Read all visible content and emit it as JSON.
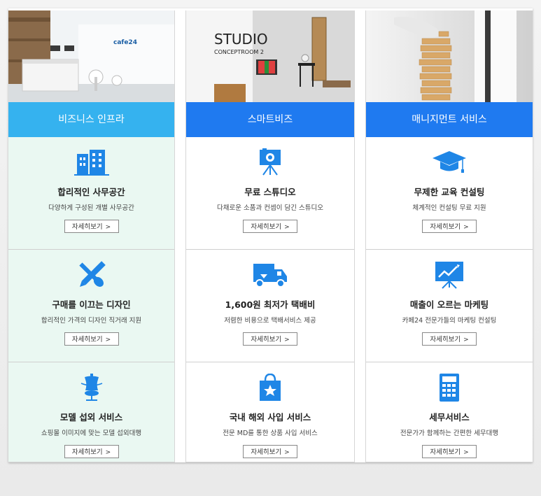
{
  "columns": [
    {
      "header": "비즈니스 인프라",
      "photo_logo": "cafe24",
      "cells": [
        {
          "icon": "building-icon",
          "title": "합리적인 사무공간",
          "desc": "다양하게 구성된 개별 사무공간",
          "button": "자세히보기"
        },
        {
          "icon": "design-tools-icon",
          "title": "구매를 이끄는 디자인",
          "desc": "합리적인 가격의 디자인 직거래 지원",
          "button": "자세히보기"
        },
        {
          "icon": "mannequin-icon",
          "title": "모델 섭외 서비스",
          "desc": "쇼핑몰 이미지에 맞는 모델 섭외대행",
          "button": "자세히보기"
        }
      ]
    },
    {
      "header": "스마트비즈",
      "photo_logo": "STUDIO",
      "photo_sub": "CONCEPTROOM 2",
      "cells": [
        {
          "icon": "camera-easel-icon",
          "title": "무료 스튜디오",
          "desc": "다채로운 소품과 컨셉이 담긴 스튜디오",
          "button": "자세히보기"
        },
        {
          "icon": "delivery-truck-icon",
          "title": "1,600원 최저가 택배비",
          "desc": "저렴한 비용으로 택배서비스 제공",
          "button": "자세히보기"
        },
        {
          "icon": "shopping-bag-icon",
          "title": "국내 해외 사입 서비스",
          "desc": "전문 MD를 통한 상품 사입 서비스",
          "button": "자세히보기"
        }
      ]
    },
    {
      "header": "매니지먼트 서비스",
      "cells": [
        {
          "icon": "graduation-cap-icon",
          "title": "무제한 교육 컨설팅",
          "desc": "체계적인 컨설팅 무료 지원",
          "button": "자세히보기"
        },
        {
          "icon": "presentation-chart-icon",
          "title": "매출이 오르는 마케팅",
          "desc": "카페24 전문가들의 마케팅 컨설팅",
          "button": "자세히보기"
        },
        {
          "icon": "calculator-icon",
          "title": "세무서비스",
          "desc": "전문가가 함께하는 간편한 세무대행",
          "button": "자세히보기"
        }
      ]
    }
  ],
  "colors": {
    "infra_header": "#35b2ef",
    "blue_header": "#1f7af0",
    "icon_blue": "#1f86e6",
    "infra_bg": "#eaf8f2"
  }
}
